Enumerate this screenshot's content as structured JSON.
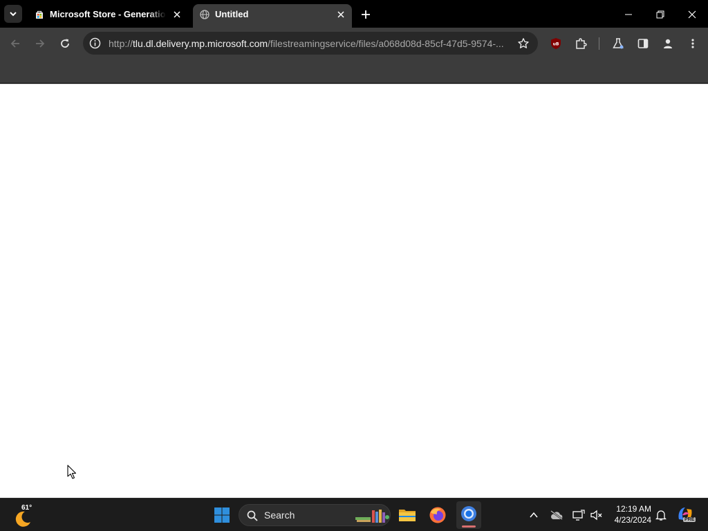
{
  "browser": {
    "tabs": [
      {
        "title": "Microsoft Store - Generation Project",
        "active": false,
        "icon": "store-bag-icon"
      },
      {
        "title": "Untitled",
        "active": true,
        "icon": "globe-icon"
      }
    ],
    "address_bar": {
      "scheme": "http://",
      "host": "tlu.dl.delivery.mp.microsoft.com",
      "path": "/filestreamingservice/files/a068d08d-85cf-47d5-9574-..."
    },
    "extension_badge": "uB"
  },
  "taskbar": {
    "weather_temp": "61°",
    "search_label": "Search",
    "clock_time": "12:19 AM",
    "clock_date": "4/23/2024",
    "copilot_badge": "PRE"
  },
  "colors": {
    "accent_blue": "#2f8fdd",
    "ublock_red": "#800000"
  }
}
